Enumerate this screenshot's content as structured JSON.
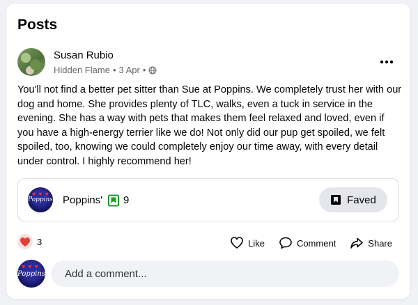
{
  "section": {
    "title": "Posts"
  },
  "post": {
    "author": "Susan Rubio",
    "group": "Hidden Flame",
    "date": "3 Apr",
    "privacy_icon": "globe-icon",
    "text": "You'll not find a better pet sitter than Sue at Poppins. We completely trust her with our dog and home. She provides plenty of TLC, walks, even a tuck in service in the evening. She has a way with pets that makes them feel relaxed and loved, even if you have a high-energy terrier like we do! Not only did our pup get spoiled, we felt spoiled, too, knowing we could completely enjoy our time away, with every detail under control. I highly recommend her!"
  },
  "page_card": {
    "name": "Poppins'",
    "avatar_text": "Poppins",
    "fav_count": "9",
    "faved_label": "Faved",
    "accent_green": "#1a9c2a"
  },
  "reactions": {
    "count": "3",
    "icon": "heart-icon"
  },
  "actions": {
    "like": "Like",
    "comment": "Comment",
    "share": "Share"
  },
  "comment": {
    "avatar_text": "Poppins",
    "placeholder": "Add a comment..."
  }
}
